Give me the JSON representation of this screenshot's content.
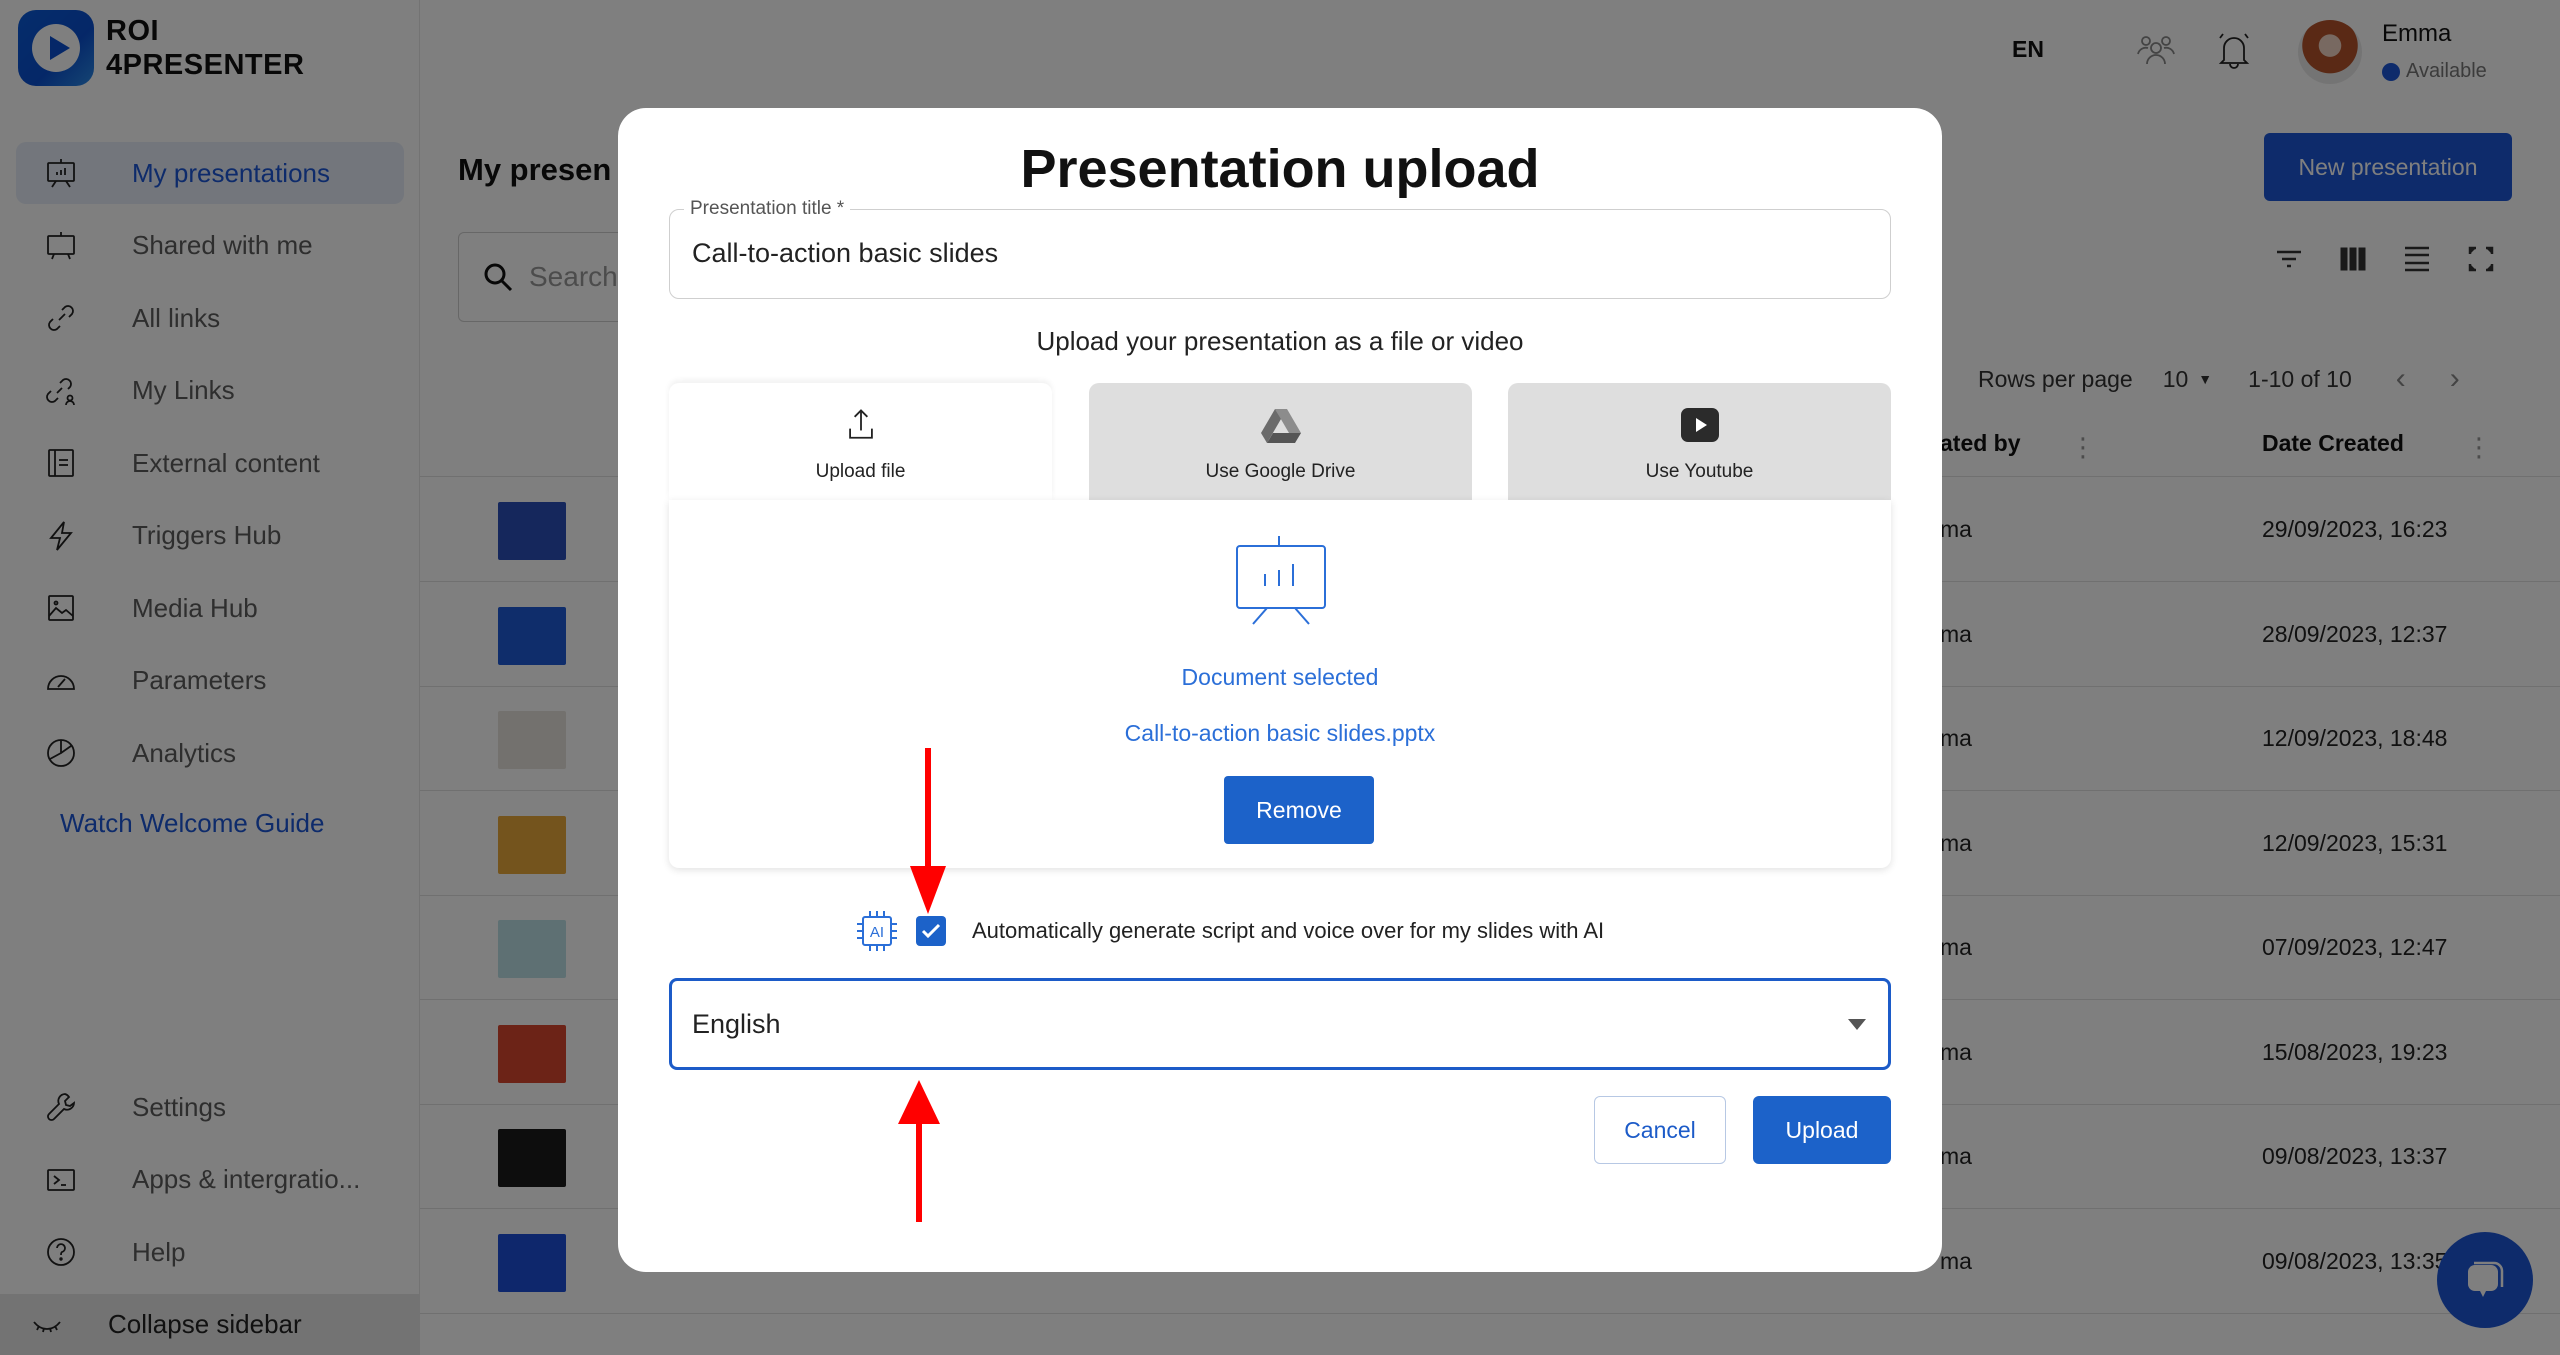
{
  "app": {
    "brand_line1": "ROI",
    "brand_line2": "4PRESENTER"
  },
  "sidebar": {
    "items": [
      {
        "label": "My presentations",
        "icon": "presentation-board-icon",
        "active": true
      },
      {
        "label": "Shared with me",
        "icon": "shared-board-icon"
      },
      {
        "label": "All links",
        "icon": "link-icon"
      },
      {
        "label": "My Links",
        "icon": "user-link-icon"
      },
      {
        "label": "External content",
        "icon": "document-icon"
      },
      {
        "label": "Triggers Hub",
        "icon": "lightning-icon"
      },
      {
        "label": "Media Hub",
        "icon": "image-icon"
      },
      {
        "label": "Parameters",
        "icon": "gauge-icon"
      },
      {
        "label": "Analytics",
        "icon": "pie-chart-icon"
      }
    ],
    "welcome_link": "Watch Welcome Guide",
    "bottom_items": [
      {
        "label": "Settings",
        "icon": "wrench-icon"
      },
      {
        "label": "Apps & intergratio...",
        "icon": "terminal-icon"
      },
      {
        "label": "Help",
        "icon": "help-circle-icon"
      }
    ],
    "collapse_label": "Collapse sidebar"
  },
  "topbar": {
    "language": "EN",
    "user_name": "Emma",
    "user_status": "Available",
    "status_color": "#1c57d6"
  },
  "main": {
    "page_title": "My presen",
    "new_button": "New presentation",
    "search_placeholder": "Search",
    "rows_per_page_label": "Rows per page",
    "rows_per_page_value": "10",
    "range": "1-10 of 10",
    "columns": [
      "ated by",
      "Date Created"
    ],
    "rows": [
      {
        "creator": "ma",
        "date": "29/09/2023, 16:23",
        "thumb": "#2a4fb8"
      },
      {
        "creator": "ma",
        "date": "28/09/2023, 12:37",
        "thumb": "#1f5ad6"
      },
      {
        "creator": "ma",
        "date": "12/09/2023, 18:48",
        "thumb": "#e7e2dc"
      },
      {
        "creator": "ma",
        "date": "12/09/2023, 15:31",
        "thumb": "#e9a83a"
      },
      {
        "creator": "ma",
        "date": "07/09/2023, 12:47",
        "thumb": "#bde0e6"
      },
      {
        "creator": "ma",
        "date": "15/08/2023, 19:23",
        "thumb": "#d9462f"
      },
      {
        "creator": "ma",
        "date": "09/08/2023, 13:37",
        "thumb": "#1a1a1a"
      },
      {
        "creator": "ma",
        "date": "09/08/2023, 13:35",
        "thumb": "#1c4fd8"
      }
    ]
  },
  "modal": {
    "title": "Presentation upload",
    "title_field_label": "Presentation title *",
    "title_field_value": "Call-to-action basic slides",
    "subtitle": "Upload your presentation as a file or video",
    "tabs": [
      {
        "label": "Upload file",
        "icon": "upload-icon",
        "active": true
      },
      {
        "label": "Use Google Drive",
        "icon": "google-drive-icon"
      },
      {
        "label": "Use Youtube",
        "icon": "youtube-icon"
      }
    ],
    "document_status": "Document selected",
    "file_name": "Call-to-action basic slides.pptx",
    "remove_button": "Remove",
    "ai_checkbox_checked": true,
    "ai_checkbox_label": "Automatically generate script and voice over for my slides with AI",
    "language_selected": "English",
    "cancel_button": "Cancel",
    "upload_button": "Upload",
    "accent_color": "#1c62c9"
  },
  "annotations": {
    "arrow_color": "#ff0000"
  }
}
